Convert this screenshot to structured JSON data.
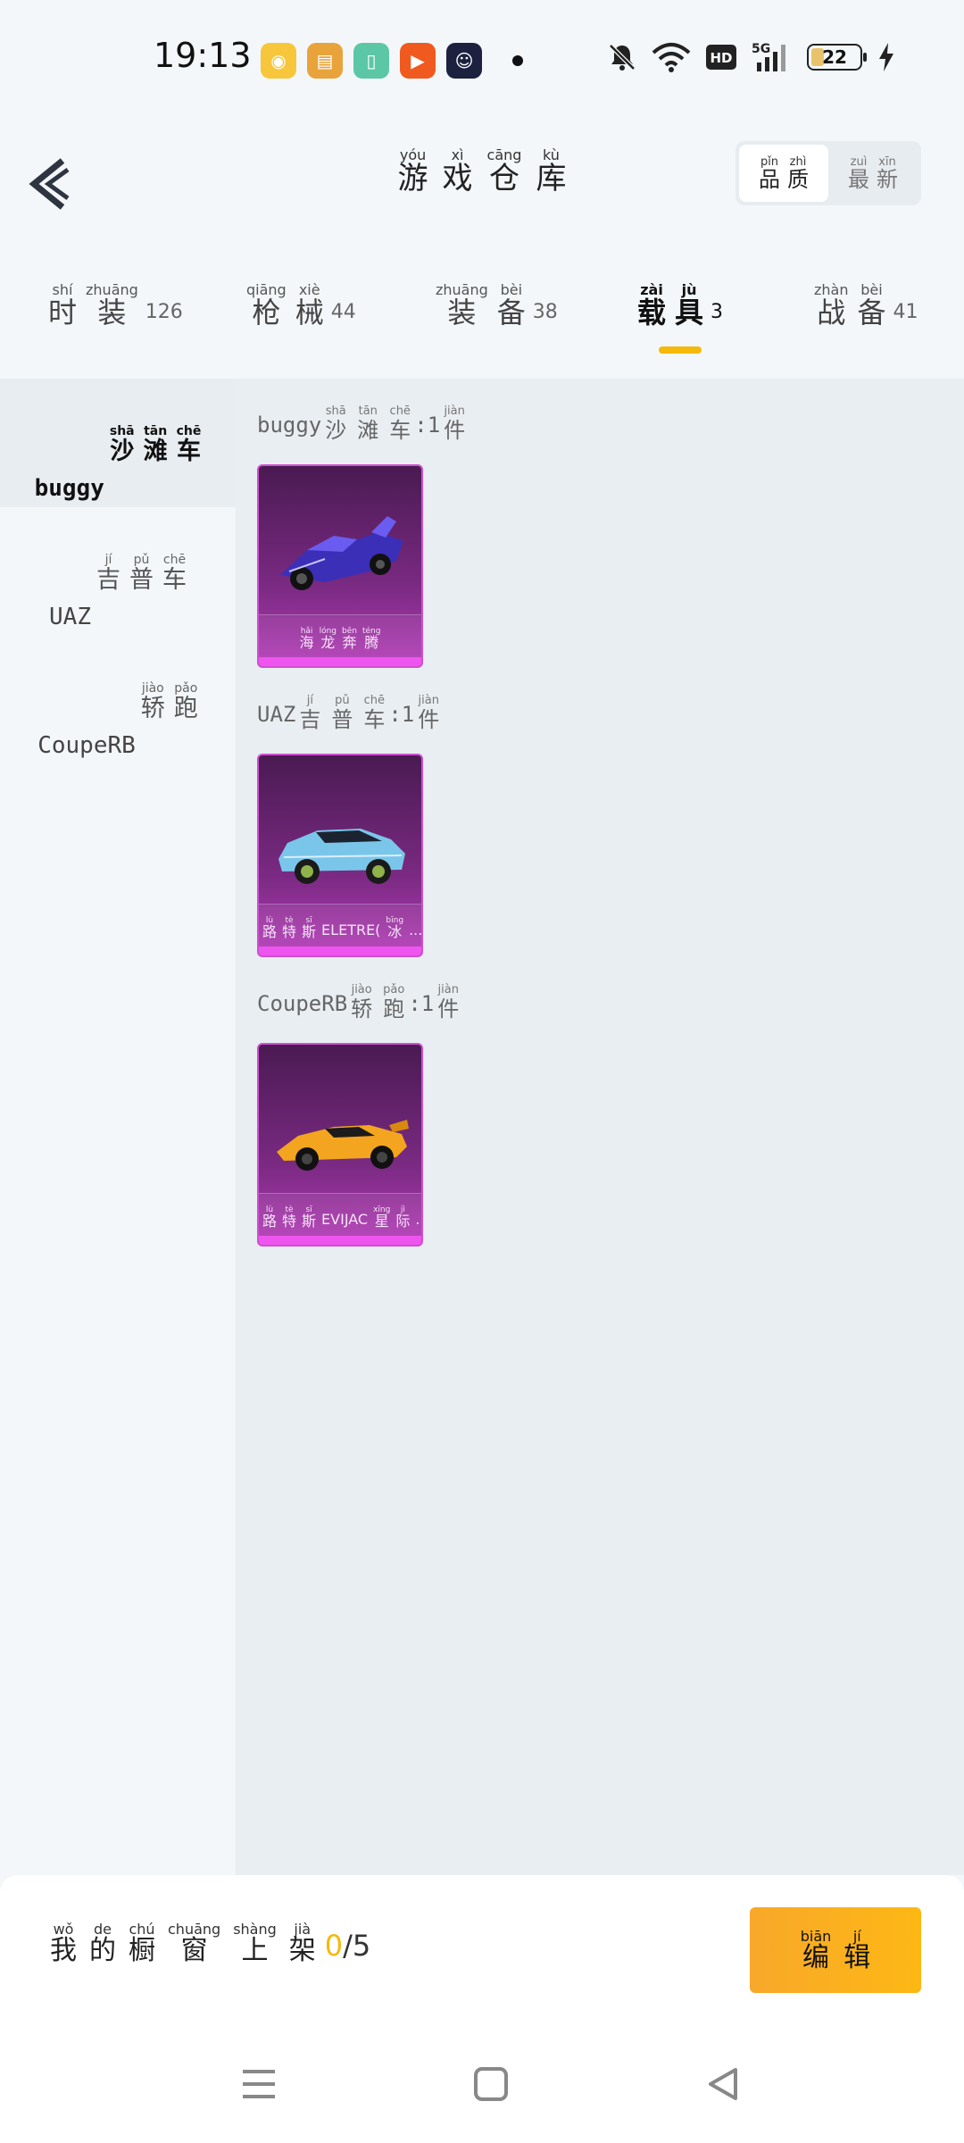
{
  "status_bar": {
    "time": "19:13",
    "battery": "22",
    "icons": [
      "bell-muted-icon",
      "wifi-icon",
      "hd-icon",
      "signal-5g-icon",
      "charging-icon"
    ]
  },
  "header": {
    "title": [
      {
        "py": "yóu",
        "hz": "游"
      },
      {
        "py": "xì",
        "hz": "戏"
      },
      {
        "py": "cāng",
        "hz": "仓"
      },
      {
        "py": "kù",
        "hz": "库"
      }
    ],
    "sort_quality": [
      {
        "py": "pǐn",
        "hz": "品"
      },
      {
        "py": "zhì",
        "hz": "质"
      }
    ],
    "sort_latest": [
      {
        "py": "zuì",
        "hz": "最"
      },
      {
        "py": "xīn",
        "hz": "新"
      }
    ]
  },
  "tabs": [
    {
      "chars": [
        {
          "py": "shí",
          "hz": "时"
        },
        {
          "py": "zhuāng",
          "hz": "装"
        }
      ],
      "count": "126"
    },
    {
      "chars": [
        {
          "py": "qiāng",
          "hz": "枪"
        },
        {
          "py": "xiè",
          "hz": "械"
        }
      ],
      "count": "44"
    },
    {
      "chars": [
        {
          "py": "zhuāng",
          "hz": "装"
        },
        {
          "py": "bèi",
          "hz": "备"
        }
      ],
      "count": "38"
    },
    {
      "chars": [
        {
          "py": "zài",
          "hz": "载"
        },
        {
          "py": "jù",
          "hz": "具"
        }
      ],
      "count": "3"
    },
    {
      "chars": [
        {
          "py": "zhàn",
          "hz": "战"
        },
        {
          "py": "bèi",
          "hz": "备"
        }
      ],
      "count": "41"
    }
  ],
  "sidebar": [
    {
      "latin": "buggy",
      "chars": [
        {
          "py": "shā",
          "hz": "沙"
        },
        {
          "py": "tān",
          "hz": "滩"
        },
        {
          "py": "chē",
          "hz": "车"
        }
      ]
    },
    {
      "latin": "UAZ",
      "chars": [
        {
          "py": "jí",
          "hz": "吉"
        },
        {
          "py": "pǔ",
          "hz": "普"
        },
        {
          "py": "chē",
          "hz": "车"
        }
      ]
    },
    {
      "latin": "CoupeRB",
      "chars": [
        {
          "py": "jiào",
          "hz": "轿"
        },
        {
          "py": "pǎo",
          "hz": "跑"
        }
      ]
    }
  ],
  "sections": [
    {
      "latin": "buggy",
      "chars": [
        {
          "py": "shā",
          "hz": "沙"
        },
        {
          "py": "tān",
          "hz": "滩"
        },
        {
          "py": "chē",
          "hz": "车"
        }
      ],
      "sep": ":1",
      "unit": {
        "py": "jiàn",
        "hz": "件"
      },
      "card": {
        "before": "",
        "chars": [
          {
            "py": "hǎi",
            "hz": "海"
          },
          {
            "py": "lóng",
            "hz": "龙"
          },
          {
            "py": "bēn",
            "hz": "奔"
          },
          {
            "py": "téng",
            "hz": "腾"
          }
        ],
        "latin": "",
        "after": [],
        "ellipsis": ""
      }
    },
    {
      "latin": "UAZ",
      "chars": [
        {
          "py": "jí",
          "hz": "吉"
        },
        {
          "py": "pǔ",
          "hz": "普"
        },
        {
          "py": "chē",
          "hz": "车"
        }
      ],
      "sep": ":1",
      "unit": {
        "py": "jiàn",
        "hz": "件"
      },
      "card": {
        "chars": [
          {
            "py": "lù",
            "hz": "路"
          },
          {
            "py": "tè",
            "hz": "特"
          },
          {
            "py": "sī",
            "hz": "斯"
          }
        ],
        "latin": "ELETRE(",
        "after": [
          {
            "py": "bīng",
            "hz": "冰"
          }
        ],
        "ellipsis": "..."
      }
    },
    {
      "latin": "CoupeRB",
      "chars": [
        {
          "py": "jiào",
          "hz": "轿"
        },
        {
          "py": "pǎo",
          "hz": "跑"
        }
      ],
      "sep": ":1",
      "unit": {
        "py": "jiàn",
        "hz": "件"
      },
      "card": {
        "chars": [
          {
            "py": "lù",
            "hz": "路"
          },
          {
            "py": "tè",
            "hz": "特"
          },
          {
            "py": "sī",
            "hz": "斯"
          }
        ],
        "latin": "EVIJAC",
        "after": [
          {
            "py": "xīng",
            "hz": "星"
          },
          {
            "py": "jì",
            "hz": "际"
          }
        ],
        "ellipsis": "..."
      }
    }
  ],
  "bottom": {
    "chars": [
      {
        "py": "wǒ",
        "hz": "我"
      },
      {
        "py": "de",
        "hz": "的"
      },
      {
        "py": "chú",
        "hz": "橱"
      },
      {
        "py": "chuāng",
        "hz": "窗"
      },
      {
        "py": "shàng",
        "hz": "上"
      },
      {
        "py": "jià",
        "hz": "架"
      }
    ],
    "count_current": "0",
    "count_total": "/5",
    "edit_chars": [
      {
        "py": "biān",
        "hz": "编"
      },
      {
        "py": "jí",
        "hz": "辑"
      }
    ]
  },
  "colors": {
    "accent": "#f5b90c",
    "card_purple": "#7a2a82",
    "card_pink": "#ee55ef"
  }
}
